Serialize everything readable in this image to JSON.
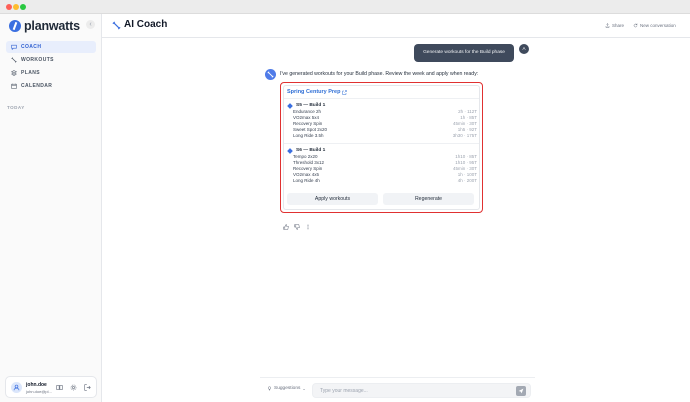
{
  "app": {
    "name": "planwatts",
    "collapse_icon": "chevron-left-icon"
  },
  "sidebar": {
    "items": [
      {
        "label": "COACH",
        "icon": "chat-icon",
        "active": true
      },
      {
        "label": "WORKOUTS",
        "icon": "dumbbell-icon",
        "active": false
      },
      {
        "label": "PLANS",
        "icon": "layers-icon",
        "active": false
      },
      {
        "label": "CALENDAR",
        "icon": "calendar-icon",
        "active": false
      }
    ],
    "section_label": "TODAY",
    "user": {
      "name": "john.doe",
      "email": "john.doe@pl..."
    }
  },
  "header": {
    "title": "AI Coach",
    "share_label": "Share",
    "new_label": "New conversation"
  },
  "chat": {
    "user_message": "Generate workouts for the Build phase",
    "user_initial": "A",
    "assistant_text": "I've generated workouts for your Build phase. Review the week and apply when ready:",
    "plan": {
      "title": "Spring Century Prep",
      "weeks": [
        {
          "label": "S5 — Build 1",
          "workouts": [
            {
              "name": "Endurance 2h",
              "meta": "2h · 112T"
            },
            {
              "name": "VO2max 5x4",
              "meta": "1h · 85T"
            },
            {
              "name": "Recovery Spin",
              "meta": "45min · 30T"
            },
            {
              "name": "Sweet Spot 2x20",
              "meta": "1h5 · 92T"
            },
            {
              "name": "Long Ride 3.5h",
              "meta": "3h30 · 175T"
            }
          ]
        },
        {
          "label": "S6 — Build 1",
          "workouts": [
            {
              "name": "Tempo 2x20",
              "meta": "1h10 · 85T"
            },
            {
              "name": "Threshold 3x12",
              "meta": "1h10 · 95T"
            },
            {
              "name": "Recovery Spin",
              "meta": "45min · 30T"
            },
            {
              "name": "VO2max 4x5",
              "meta": "1h · 100T"
            },
            {
              "name": "Long Ride 4h",
              "meta": "4h · 200T"
            }
          ]
        }
      ],
      "apply_label": "Apply workouts",
      "regenerate_label": "Regenerate"
    }
  },
  "composer": {
    "suggestions_label": "Suggestions",
    "placeholder": "Type your message..."
  },
  "colors": {
    "accent": "#3b6fe0",
    "highlight": "#e03131",
    "user_bubble": "#3f4a5c"
  }
}
